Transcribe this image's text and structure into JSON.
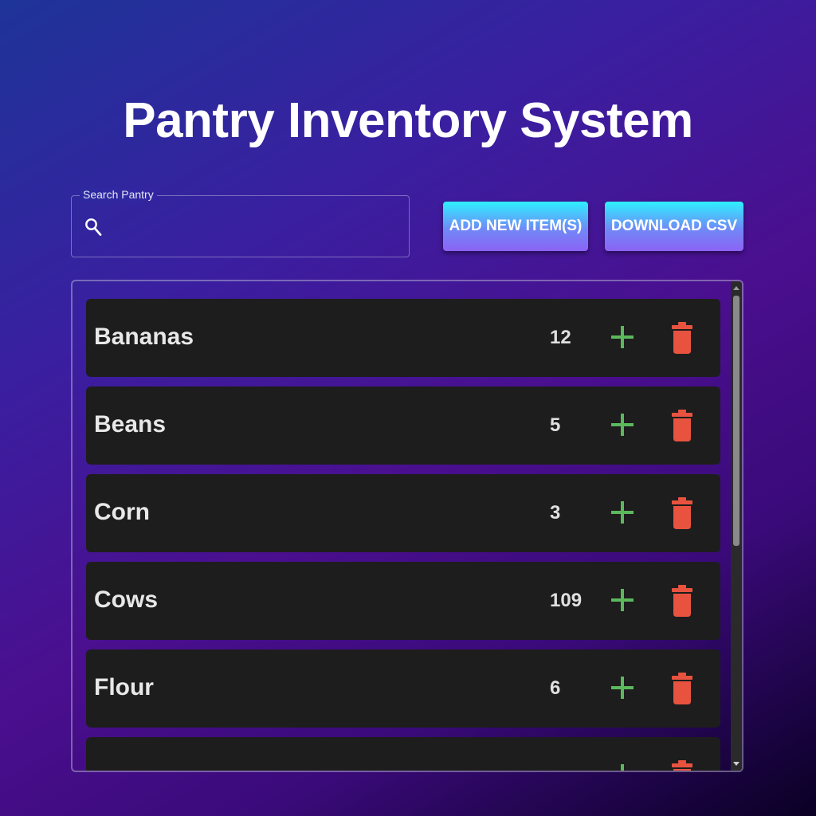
{
  "header": {
    "title": "Pantry Inventory System"
  },
  "search": {
    "label": "Search Pantry",
    "value": "",
    "placeholder": ""
  },
  "actions": {
    "add_label": "Add New Item(s)",
    "download_label": "Download CSV"
  },
  "colors": {
    "add": "#5cb85c",
    "delete": "#e8533f",
    "row_bg": "#1d1d1d"
  },
  "items": [
    {
      "name": "Bananas",
      "qty": "12"
    },
    {
      "name": "Beans",
      "qty": "5"
    },
    {
      "name": "Corn",
      "qty": "3"
    },
    {
      "name": "Cows",
      "qty": "109"
    },
    {
      "name": "Flour",
      "qty": "6"
    },
    {
      "name": "",
      "qty": ""
    }
  ]
}
